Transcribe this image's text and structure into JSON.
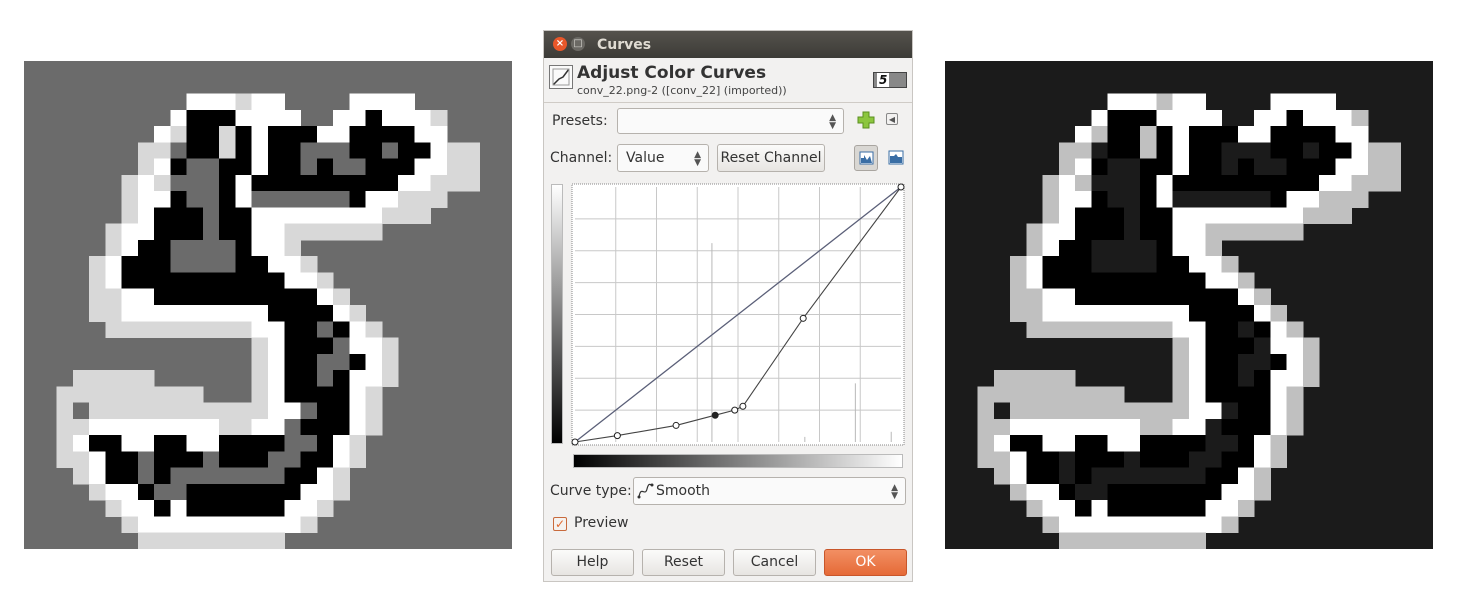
{
  "dialog": {
    "window_title": "Curves",
    "heading": "Adjust Color Curves",
    "subtitle": "conv_22.png-2 ([conv_22] (imported))",
    "thumbnail_text": "5",
    "presets_label": "Presets:",
    "presets_value": "",
    "channel_label": "Channel:",
    "channel_value": "Value",
    "reset_channel_label": "Reset Channel",
    "curve_type_label": "Curve type:",
    "curve_type_value": "Smooth",
    "preview_label": "Preview",
    "preview_checked": true,
    "buttons": {
      "help": "Help",
      "reset": "Reset",
      "cancel": "Cancel",
      "ok": "OK"
    },
    "accent_color": "#e56a37",
    "curve_points": [
      [
        0,
        0
      ],
      [
        0.13,
        0.025
      ],
      [
        0.31,
        0.065
      ],
      [
        0.43,
        0.105
      ],
      [
        0.49,
        0.125
      ],
      [
        0.515,
        0.14
      ],
      [
        0.7,
        0.485
      ],
      [
        1,
        1
      ]
    ],
    "selected_point": 3
  },
  "icons": [
    "close-icon",
    "maximize-icon",
    "curves-tool-icon",
    "add-preset-icon",
    "preset-menu-icon",
    "linear-histogram-icon",
    "logarithmic-histogram-icon",
    "smooth-curve-icon",
    "checkmark-icon"
  ],
  "images": {
    "left": {
      "background": "#6b6b6b"
    },
    "right": {
      "background": "#1b1b1b"
    }
  }
}
